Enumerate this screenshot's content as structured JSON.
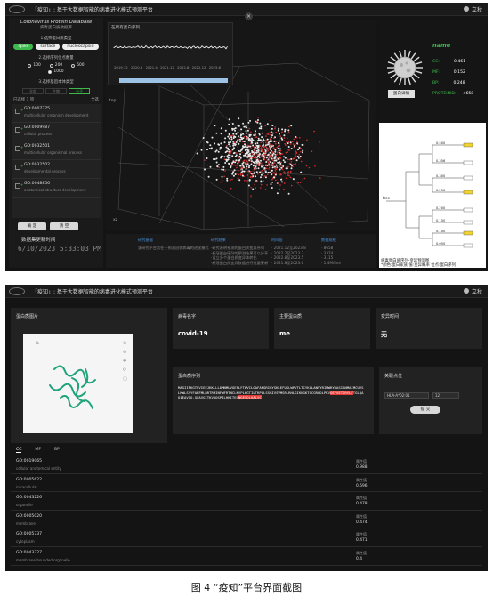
{
  "app": {
    "title": "「疫知」: 基于大数据智能的病毒进化模式预测平台",
    "user_label": "立秋"
  },
  "sidebar": {
    "title": "Coronavirus Protein Database",
    "subtitle": "病毒蛋白质数据库",
    "section1": "1.选择蛋白质类型",
    "protein_types": [
      "spike",
      "surface",
      "nucleocapsid"
    ],
    "protein_selected": "spike",
    "section2": "2.选择序列位点数量",
    "site_options": [
      "100",
      "200",
      "500",
      "1000"
    ],
    "site_selected": "1000",
    "section3": "3.选择基因本体类型",
    "ontology_ops": [
      "全部",
      "生物",
      "分子"
    ],
    "ontology_selected": "分子",
    "count_label": "已选择 1 项",
    "count_link": "全选",
    "go_terms": [
      {
        "id": "GO:0007275",
        "desc": "multicellular organism development"
      },
      {
        "id": "GO:0009987",
        "desc": "cellular process"
      },
      {
        "id": "GO:0032501",
        "desc": "multicellular organismal process"
      },
      {
        "id": "GO:0032502",
        "desc": "developmental process"
      },
      {
        "id": "GO:0048856",
        "desc": "anatomical structure development"
      }
    ],
    "btn_ok": "确 定",
    "btn_reset": "清 空",
    "time_label": "数据集更新时间",
    "time_value": "6/10/2023 5:33:03 PM"
  },
  "timeline": {
    "title": "在所有蛋白序列",
    "ticks": [
      "2019.12",
      "2020.8",
      "2021.4",
      "2021.12",
      "2022.8",
      "2022.12",
      "2023.8"
    ]
  },
  "scatter": {
    "axis_top": "top",
    "axis_bottom": "xz",
    "series_colors": {
      "primary": "#e8e8e8",
      "secondary": "#d32f2f"
    }
  },
  "virus_card": {
    "name": "name",
    "stats": [
      {
        "label": "CC:",
        "value": "0.461"
      },
      {
        "label": "MF:",
        "value": "0.152"
      },
      {
        "label": "BP:",
        "value": "0.248"
      },
      {
        "label": "PROTEINID:",
        "value": "4658"
      }
    ],
    "btn": "蛋白详情"
  },
  "tree": {
    "caption_line1": "病毒蛋白质序列-变异预测图",
    "caption_line2": "*颜色:蛋白家族 值:变异概率 位点:蛋白序列",
    "left_label": "tree",
    "values": [
      "0.500",
      "0.356",
      "0.300",
      "0.250",
      "0.200",
      "0.150",
      "0.100",
      "0.050",
      "0.000"
    ]
  },
  "info_panel": {
    "cols": [
      {
        "h": "研究基础",
        "rows": [
          "该研究平台旨在于预测冠状病毒的进化模式"
        ]
      },
      {
        "h": "研究结果",
        "rows": [
          "·研究表明预测的蛋白质变异序列",
          "·新冠蛋白序列的预测结果可以分享",
          "·设立多个蛋白质变异体转化",
          "·新冠蛋白质变异数据进行批量更新"
        ]
      },
      {
        "h": "时间段",
        "rows": [
          "· 2021.12至2023.8",
          "· 2022.2至2023.3",
          "· 2022.8至2023.5",
          "· 2021.8至2023.6"
        ]
      },
      {
        "h": "数据规模",
        "rows": [
          "· 8658",
          "· 3374",
          "· 3115",
          "· 1.4M/line"
        ]
      }
    ]
  },
  "detail": {
    "image_label": "蛋白质图片",
    "name_label": "病毒名字",
    "name_value": "covid-19",
    "family_label": "主要蛋白质",
    "family_value": "me",
    "time_label": "变异时间",
    "time_value": "无",
    "seq_label": "蛋白质序列",
    "sequence_normal": "MAGIIRKGTFVIEEJKKLLLDMNMLVGEFLFTWVCLQAFANGRIGYSKLEFUKLWPVTLTCYKLLANVYRINWRYRASIANMAIMCUVSLMWLSYYFAKFMLRRTRMINFWFRTNCLNVPLHGTILTRPLLSSGIVSVMSRLRHLGIKNGKTCCGRGDLPKV",
    "sequence_highlight": "GEYVETSRYLF",
    "sequence_tail": "TGLQAQIEAVIQ.GFAVGITKVDQSPILHKITEG",
    "sequence_tail_hl": "NGESDLQALVC",
    "sequence_end": "",
    "match_label": "关联点位",
    "match_input": "HLA-A*02:01",
    "match_num": "12",
    "match_btn": "提 交",
    "tabs": [
      "CC",
      "MF",
      "BP"
    ],
    "tab_selected": "CC",
    "score_label": "属性值",
    "rows": [
      {
        "id": "GO:0019065",
        "desc": "cellular anatomical entity",
        "score": "0.988"
      },
      {
        "id": "GO:0005622",
        "desc": "intracellular",
        "score": "0.596"
      },
      {
        "id": "GO:0043226",
        "desc": "organelle",
        "score": "0.478"
      },
      {
        "id": "GO:0005020",
        "desc": "membrane",
        "score": "0.474"
      },
      {
        "id": "GO:0005737",
        "desc": "cytoplasm",
        "score": "0.471"
      },
      {
        "id": "GO:0043227",
        "desc": "membrane-bounded organelle",
        "score": "0.4"
      }
    ]
  },
  "caption": "图 4 “疫知”平台界面截图"
}
